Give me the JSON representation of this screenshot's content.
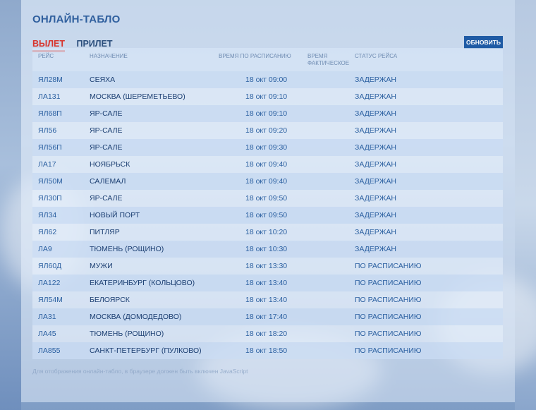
{
  "page": {
    "title": "ОНЛАЙН-ТАБЛО",
    "tabs": [
      {
        "label": "ВЫЛЕТ",
        "active": true
      },
      {
        "label": "ПРИЛЕТ",
        "active": false
      }
    ],
    "refresh_label": "ОБНОВИТЬ"
  },
  "table": {
    "headers": {
      "flight": "РЕЙС",
      "destination": "НАЗНАЧЕНИЕ",
      "scheduled": "ВРЕМЯ ПО РАСПИСАНИЮ",
      "actual": "ВРЕМЯ ФАКТИЧЕСКОЕ",
      "status": "СТАТУС РЕЙСА"
    },
    "rows": [
      {
        "flight": "ЯЛ28М",
        "destination": "СЕЯХА",
        "scheduled": "18 окт 09:00",
        "actual": "",
        "status": "ЗАДЕРЖАН"
      },
      {
        "flight": "ЛА131",
        "destination": "МОСКВА (ШЕРЕМЕТЬЕВО)",
        "scheduled": "18 окт 09:10",
        "actual": "",
        "status": "ЗАДЕРЖАН"
      },
      {
        "flight": "ЯЛ68П",
        "destination": "ЯР-САЛЕ",
        "scheduled": "18 окт 09:10",
        "actual": "",
        "status": "ЗАДЕРЖАН"
      },
      {
        "flight": "ЯЛ56",
        "destination": "ЯР-САЛЕ",
        "scheduled": "18 окт 09:20",
        "actual": "",
        "status": "ЗАДЕРЖАН"
      },
      {
        "flight": "ЯЛ56П",
        "destination": "ЯР-САЛЕ",
        "scheduled": "18 окт 09:30",
        "actual": "",
        "status": "ЗАДЕРЖАН"
      },
      {
        "flight": "ЛА17",
        "destination": "НОЯБРЬСК",
        "scheduled": "18 окт 09:40",
        "actual": "",
        "status": "ЗАДЕРЖАН"
      },
      {
        "flight": "ЯЛ50М",
        "destination": "САЛЕМАЛ",
        "scheduled": "18 окт 09:40",
        "actual": "",
        "status": "ЗАДЕРЖАН"
      },
      {
        "flight": "ЯЛ30П",
        "destination": "ЯР-САЛЕ",
        "scheduled": "18 окт 09:50",
        "actual": "",
        "status": "ЗАДЕРЖАН"
      },
      {
        "flight": "ЯЛ34",
        "destination": "НОВЫЙ ПОРТ",
        "scheduled": "18 окт 09:50",
        "actual": "",
        "status": "ЗАДЕРЖАН"
      },
      {
        "flight": "ЯЛ62",
        "destination": "ПИТЛЯР",
        "scheduled": "18 окт 10:20",
        "actual": "",
        "status": "ЗАДЕРЖАН"
      },
      {
        "flight": "ЛА9",
        "destination": "ТЮМЕНЬ (РОЩИНО)",
        "scheduled": "18 окт 10:30",
        "actual": "",
        "status": "ЗАДЕРЖАН"
      },
      {
        "flight": "ЯЛ60Д",
        "destination": "МУЖИ",
        "scheduled": "18 окт 13:30",
        "actual": "",
        "status": "ПО РАСПИСАНИЮ"
      },
      {
        "flight": "ЛА122",
        "destination": "ЕКАТЕРИНБУРГ (КОЛЬЦОВО)",
        "scheduled": "18 окт 13:40",
        "actual": "",
        "status": "ПО РАСПИСАНИЮ"
      },
      {
        "flight": "ЯЛ54М",
        "destination": "БЕЛОЯРСК",
        "scheduled": "18 окт 13:40",
        "actual": "",
        "status": "ПО РАСПИСАНИЮ"
      },
      {
        "flight": "ЛА31",
        "destination": "МОСКВА (ДОМОДЕДОВО)",
        "scheduled": "18 окт 17:40",
        "actual": "",
        "status": "ПО РАСПИСАНИЮ"
      },
      {
        "flight": "ЛА45",
        "destination": "ТЮМЕНЬ (РОЩИНО)",
        "scheduled": "18 окт 18:20",
        "actual": "",
        "status": "ПО РАСПИСАНИЮ"
      },
      {
        "flight": "ЛА855",
        "destination": "САНКТ-ПЕТЕРБУРГ (ПУЛКОВО)",
        "scheduled": "18 окт 18:50",
        "actual": "",
        "status": "ПО РАСПИСАНИЮ"
      }
    ]
  },
  "footer": {
    "note": "Для отображения онлайн-табло, в браузере должен быть включен JavaScript"
  },
  "colors": {
    "accent_red": "#d8332b",
    "button_blue": "#1f5ba5",
    "title_blue": "#2f5f9e"
  }
}
